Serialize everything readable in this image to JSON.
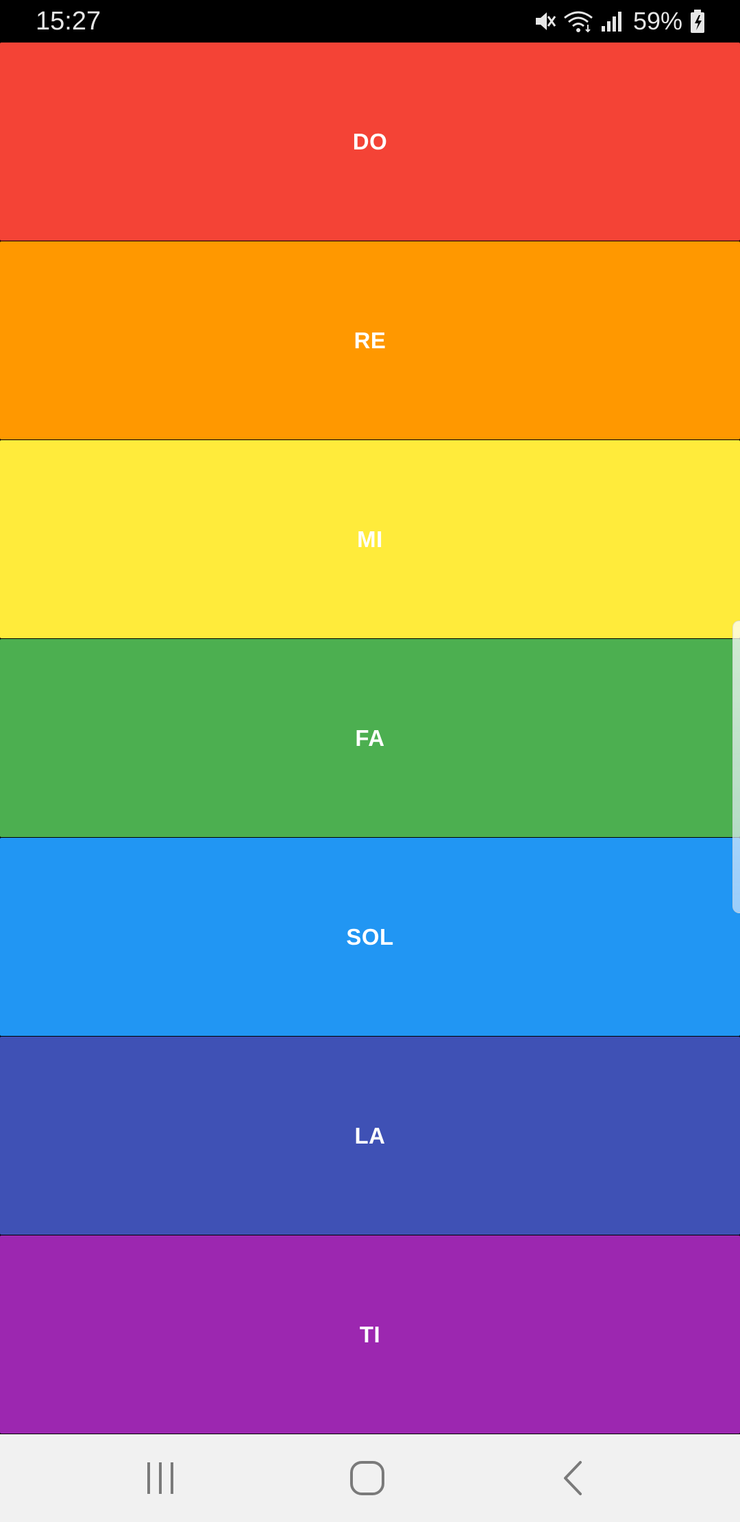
{
  "status_bar": {
    "time": "15:27",
    "battery_percent": "59%",
    "icons": [
      "mute-icon",
      "wifi-icon",
      "signal-icon",
      "battery-charging-icon"
    ]
  },
  "keys": [
    {
      "label": "DO",
      "color": "#F44336"
    },
    {
      "label": "RE",
      "color": "#FF9800"
    },
    {
      "label": "MI",
      "color": "#FFEB3B"
    },
    {
      "label": "FA",
      "color": "#4CAF50"
    },
    {
      "label": "SOL",
      "color": "#2196F3"
    },
    {
      "label": "LA",
      "color": "#3F51B5"
    },
    {
      "label": "TI",
      "color": "#9C27B0"
    }
  ],
  "nav_bar": {
    "icons": [
      "recent-apps-icon",
      "home-icon",
      "back-icon"
    ]
  }
}
